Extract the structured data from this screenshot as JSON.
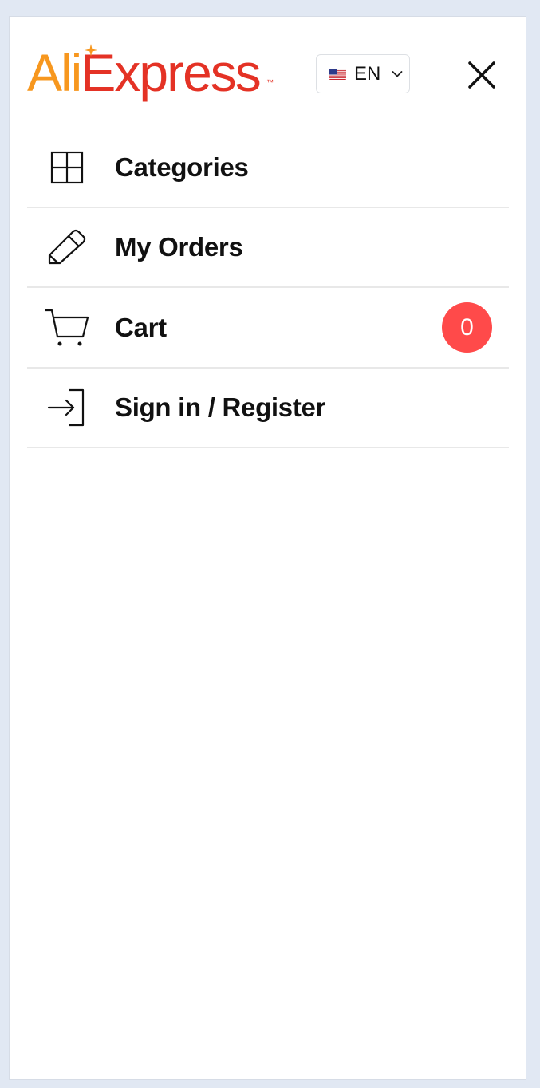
{
  "header": {
    "logo": {
      "ali": "Ali",
      "express": "Express",
      "tm": "™"
    },
    "language": {
      "flag": "us-flag-icon",
      "code": "EN"
    },
    "close_icon": "close-icon"
  },
  "menu": {
    "items": [
      {
        "label": "Categories",
        "icon": "grid-icon"
      },
      {
        "label": "My Orders",
        "icon": "pencil-icon"
      },
      {
        "label": "Cart",
        "icon": "cart-icon",
        "badge": "0"
      },
      {
        "label": "Sign in / Register",
        "icon": "sign-in-icon"
      }
    ]
  },
  "colors": {
    "background": "#e1e8f3",
    "logo_orange": "#f7971e",
    "logo_red": "#e43225",
    "badge": "#ff4a4a"
  }
}
